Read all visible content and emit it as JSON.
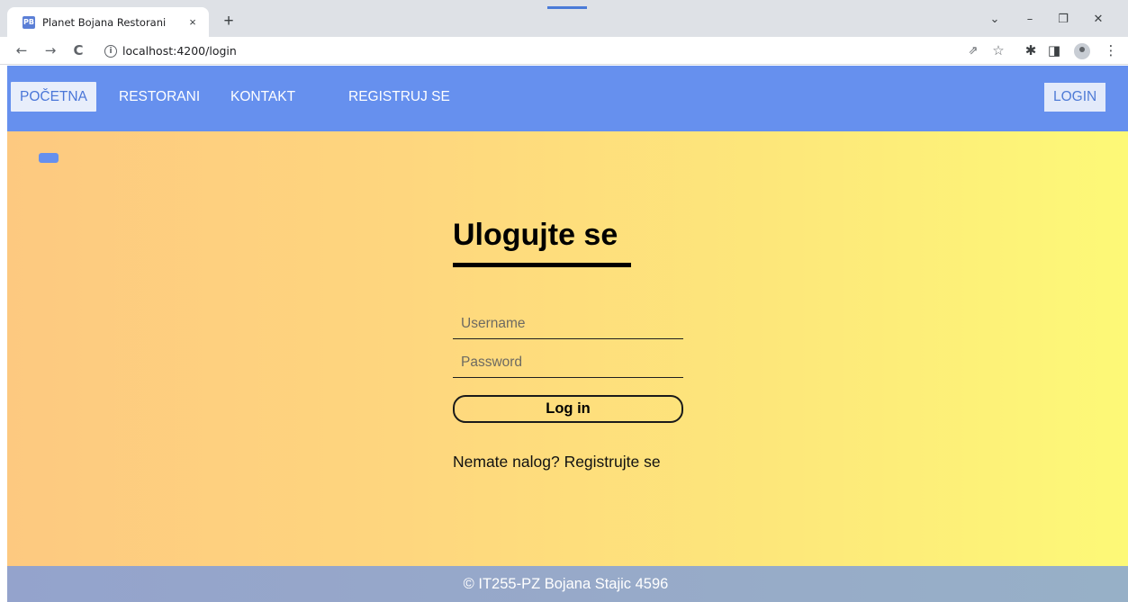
{
  "browser": {
    "tab": {
      "favicon_text": "PB",
      "title": "Planet Bojana Restorani",
      "close_glyph": "×"
    },
    "new_tab_glyph": "+",
    "window_controls": {
      "dropdown": "⌄",
      "minimize": "–",
      "restore": "❐",
      "close": "✕"
    },
    "nav_glyphs": {
      "back": "←",
      "forward": "→",
      "reload": "C"
    },
    "url": "localhost:4200/login",
    "toolbar_glyphs": {
      "share": "⇗",
      "bookmark": "☆",
      "extensions": "✱",
      "side_panel": "◨",
      "menu": "⋮"
    }
  },
  "app": {
    "nav": {
      "items": [
        {
          "label": "POČETNA",
          "active": true
        },
        {
          "label": "RESTORANI",
          "active": false
        },
        {
          "label": "KONTAKT",
          "active": false
        },
        {
          "label": "REGISTRUJ SE",
          "active": false
        }
      ],
      "login_label": "LOGIN"
    },
    "login": {
      "title": "Ulogujte se",
      "username_placeholder": "Username",
      "password_placeholder": "Password",
      "button_label": "Log in",
      "register_prompt": "Nemate nalog? ",
      "register_link": "Registrujte se"
    },
    "footer": {
      "text": "© IT255-PZ Bojana Stajic 4596"
    }
  },
  "colors": {
    "nav_bg": "#6690ee",
    "active_nav_bg": "#e8eefb",
    "gradient_start": "#fdc980",
    "gradient_end": "#fdf977",
    "footer_bg": "#96a9c9"
  }
}
